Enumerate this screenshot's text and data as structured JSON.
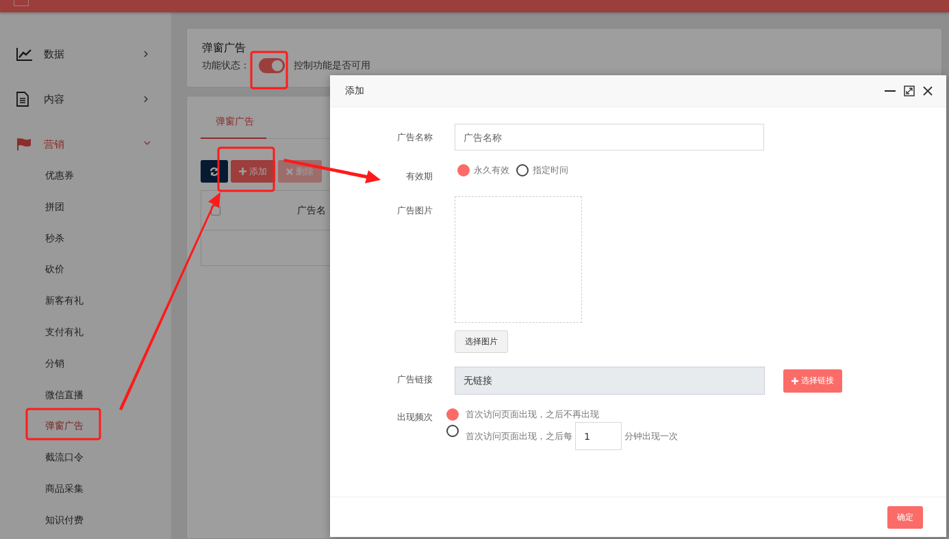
{
  "sidebar": {
    "items": [
      {
        "label": "数据",
        "expanded": false,
        "selected": false
      },
      {
        "label": "内容",
        "expanded": false,
        "selected": false
      },
      {
        "label": "营销",
        "expanded": true,
        "selected": true,
        "children": [
          {
            "label": "优惠券",
            "selected": false
          },
          {
            "label": "拼团",
            "selected": false
          },
          {
            "label": "秒杀",
            "selected": false
          },
          {
            "label": "砍价",
            "selected": false
          },
          {
            "label": "新客有礼",
            "selected": false
          },
          {
            "label": "支付有礼",
            "selected": false
          },
          {
            "label": "分销",
            "selected": false
          },
          {
            "label": "微信直播",
            "selected": false
          },
          {
            "label": "弹窗广告",
            "selected": true
          },
          {
            "label": "截流口令",
            "selected": false
          },
          {
            "label": "商品采集",
            "selected": false
          },
          {
            "label": "知识付费",
            "selected": false
          }
        ]
      }
    ]
  },
  "page": {
    "title": "弹窗广告",
    "status_label": "功能状态：",
    "toggle": {
      "on": true
    },
    "status_hint": "控制功能是否可用"
  },
  "tabs": [
    {
      "label": "弹窗广告",
      "selected": true
    }
  ],
  "toolbar": {
    "buttons": [
      {
        "kind": "refresh",
        "disabled": false
      },
      {
        "kind": "add",
        "label": "添加",
        "disabled": false
      },
      {
        "kind": "delete",
        "label": "删除",
        "disabled": true
      }
    ]
  },
  "table": {
    "header_checkbox": {
      "checked": false
    },
    "columns": [
      "广告名"
    ]
  },
  "dialog": {
    "title": "添加",
    "fields": [
      {
        "kind": "text",
        "label": "广告名称",
        "placeholder": "广告名称"
      },
      {
        "kind": "radio",
        "label": "有效期",
        "options": [
          {
            "label": "永久有效",
            "selected": true
          },
          {
            "label": "指定时间",
            "selected": false
          }
        ]
      },
      {
        "kind": "image",
        "label": "广告图片",
        "button": "选择图片"
      },
      {
        "kind": "link",
        "label": "广告链接",
        "value": "无链接",
        "button": "选择链接"
      },
      {
        "kind": "frequency",
        "label": "出现频次",
        "options": [
          {
            "label": "首次访问页面出现，之后不再出现",
            "selected": true
          },
          {
            "label": "首次访问页面出现，之后每",
            "value": "1",
            "suffix": "分钟出现一次",
            "selected": false
          }
        ]
      }
    ],
    "confirm": "确定"
  }
}
